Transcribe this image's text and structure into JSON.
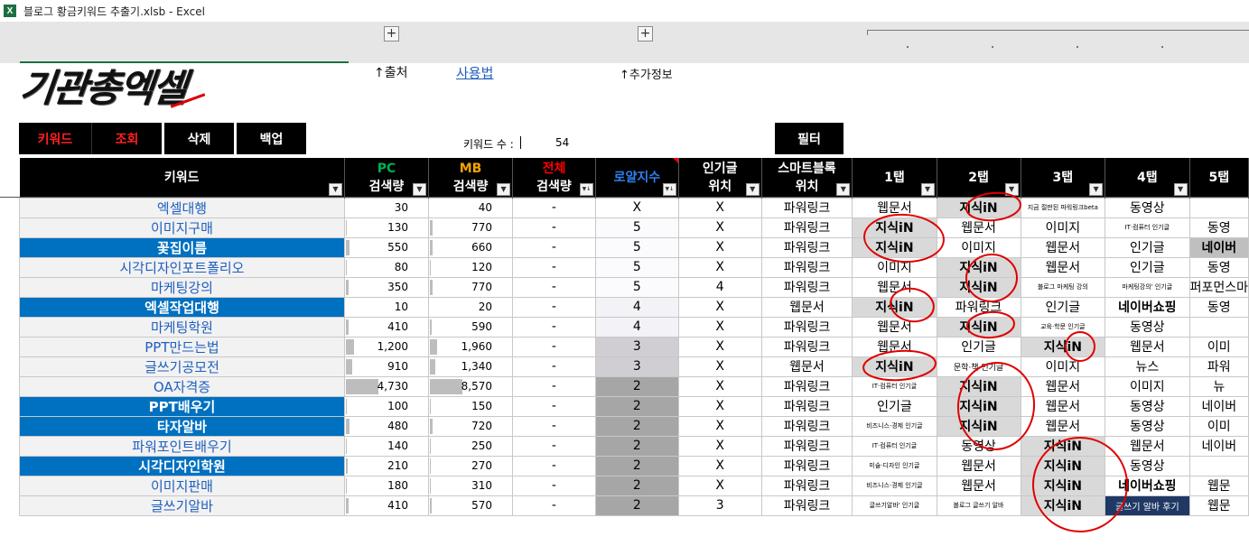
{
  "window": {
    "title": "블로그 황금키워드 추출기.xlsb - Excel",
    "icon": "excel-icon"
  },
  "ribbon": {
    "expand_buttons": [
      "+",
      "+"
    ]
  },
  "logo": {
    "text": "기관총엑셀"
  },
  "links": {
    "source": "↑출처",
    "usage": "사용법",
    "extra_info": "↑추가정보"
  },
  "buttons": {
    "keyword": "키워드",
    "lookup": "조회",
    "delete": "삭제",
    "backup": "백업",
    "filter": "필터"
  },
  "keyword_count": {
    "label": "키워드 수 :",
    "value": "54"
  },
  "colors": {
    "header_bg": "#000000",
    "highlight_blue": "#0070c0",
    "link_blue": "#1f5fbf",
    "pc_green": "#00b050",
    "mb_orange": "#f4a300",
    "total_red": "#ff0000",
    "royal_blue": "#2f80ed",
    "annotation_red": "#e00000"
  },
  "columns": [
    {
      "line1": "키워드",
      "line2": "",
      "color": "#ffffff"
    },
    {
      "line1": "PC",
      "line2": "검색량",
      "color": "#00b050"
    },
    {
      "line1": "MB",
      "line2": "검색량",
      "color": "#f4a300"
    },
    {
      "line1": "전체",
      "line2": "검색량",
      "color": "#ff0000"
    },
    {
      "line1": "로얄지수",
      "line2": "",
      "color": "#2f80ed"
    },
    {
      "line1": "인기글",
      "line2": "위치",
      "color": "#ffffff"
    },
    {
      "line1": "스마트블록",
      "line2": "위치",
      "color": "#ffffff"
    },
    {
      "line1": "1탭",
      "line2": "",
      "color": "#ffffff"
    },
    {
      "line1": "2탭",
      "line2": "",
      "color": "#ffffff"
    },
    {
      "line1": "3탭",
      "line2": "",
      "color": "#ffffff"
    },
    {
      "line1": "4탭",
      "line2": "",
      "color": "#ffffff"
    },
    {
      "line1": "5탭",
      "line2": "",
      "color": "#ffffff"
    }
  ],
  "rows": [
    {
      "kw": "엑셀대행",
      "hl": false,
      "pc": "30",
      "mb": "40",
      "total": "-",
      "royal": "X",
      "pop": "X",
      "smart": "파워링크",
      "t": [
        "웹문서",
        "지식iN",
        "지금 절판된 파워링크beta",
        "동영상",
        ""
      ]
    },
    {
      "kw": "이미지구매",
      "hl": false,
      "pc": "130",
      "mb": "770",
      "total": "-",
      "royal": "5",
      "pop": "X",
      "smart": "파워링크",
      "t": [
        "지식iN",
        "웹문서",
        "이미지",
        "IT·컴퓨터 인기글",
        "동영"
      ]
    },
    {
      "kw": "꽃집이름",
      "hl": true,
      "pc": "550",
      "mb": "660",
      "total": "-",
      "royal": "5",
      "pop": "X",
      "smart": "파워링크",
      "t": [
        "지식iN",
        "이미지",
        "웹문서",
        "인기글",
        "네이버"
      ]
    },
    {
      "kw": "시각디자인포트폴리오",
      "hl": false,
      "pc": "80",
      "mb": "120",
      "total": "-",
      "royal": "5",
      "pop": "X",
      "smart": "파워링크",
      "t": [
        "이미지",
        "지식iN",
        "웹문서",
        "인기글",
        "동영"
      ]
    },
    {
      "kw": "마케팅강의",
      "hl": false,
      "pc": "350",
      "mb": "770",
      "total": "-",
      "royal": "5",
      "pop": "4",
      "smart": "파워링크",
      "t": [
        "웹문서",
        "지식iN",
        "블로그 마케팅 강의",
        "마케팅강의' 인기글",
        "퍼포먼스마"
      ]
    },
    {
      "kw": "엑셀작업대행",
      "hl": true,
      "pc": "10",
      "mb": "20",
      "total": "-",
      "royal": "4",
      "pop": "X",
      "smart": "웹문서",
      "t": [
        "지식iN",
        "파워링크",
        "인기글",
        "네이버쇼핑",
        "동영"
      ]
    },
    {
      "kw": "마케팅학원",
      "hl": false,
      "pc": "410",
      "mb": "590",
      "total": "-",
      "royal": "4",
      "pop": "X",
      "smart": "파워링크",
      "t": [
        "웹문서",
        "지식iN",
        "교육·학문 인기글",
        "동영상",
        ""
      ]
    },
    {
      "kw": "PPT만드는법",
      "hl": false,
      "pc": "1,200",
      "mb": "1,960",
      "total": "-",
      "royal": "3",
      "pop": "X",
      "smart": "파워링크",
      "t": [
        "웹문서",
        "인기글",
        "지식iN",
        "웹문서",
        "이미"
      ]
    },
    {
      "kw": "글쓰기공모전",
      "hl": false,
      "pc": "910",
      "mb": "1,340",
      "total": "-",
      "royal": "3",
      "pop": "X",
      "smart": "웹문서",
      "t": [
        "지식iN",
        "문학·책 인기글",
        "이미지",
        "뉴스",
        "파워"
      ]
    },
    {
      "kw": "OA자격증",
      "hl": false,
      "pc": "4,730",
      "mb": "8,570",
      "total": "-",
      "royal": "2",
      "pop": "X",
      "smart": "파워링크",
      "t": [
        "IT·컴퓨터 인기글",
        "지식iN",
        "웹문서",
        "이미지",
        "뉴"
      ]
    },
    {
      "kw": "PPT배우기",
      "hl": true,
      "pc": "100",
      "mb": "150",
      "total": "-",
      "royal": "2",
      "pop": "X",
      "smart": "파워링크",
      "t": [
        "인기글",
        "지식iN",
        "웹문서",
        "동영상",
        "네이버"
      ]
    },
    {
      "kw": "타자알바",
      "hl": true,
      "pc": "480",
      "mb": "720",
      "total": "-",
      "royal": "2",
      "pop": "X",
      "smart": "파워링크",
      "t": [
        "비즈니스·경제 인기글",
        "지식iN",
        "웹문서",
        "동영상",
        "이미"
      ]
    },
    {
      "kw": "파워포인트배우기",
      "hl": false,
      "pc": "140",
      "mb": "250",
      "total": "-",
      "royal": "2",
      "pop": "X",
      "smart": "파워링크",
      "t": [
        "IT·컴퓨터 인기글",
        "동영상",
        "지식iN",
        "웹문서",
        "네이버"
      ]
    },
    {
      "kw": "시각디자인학원",
      "hl": true,
      "pc": "210",
      "mb": "270",
      "total": "-",
      "royal": "2",
      "pop": "X",
      "smart": "파워링크",
      "t": [
        "미술·디자인 인기글",
        "웹문서",
        "지식iN",
        "동영상",
        ""
      ]
    },
    {
      "kw": "이미지판매",
      "hl": false,
      "pc": "180",
      "mb": "310",
      "total": "-",
      "royal": "2",
      "pop": "X",
      "smart": "파워링크",
      "t": [
        "비즈니스·경제 인기글",
        "웹문서",
        "지식iN",
        "네이버쇼핑",
        "웹문"
      ]
    },
    {
      "kw": "글쓰기알바",
      "hl": false,
      "pc": "410",
      "mb": "570",
      "total": "-",
      "royal": "2",
      "pop": "3",
      "smart": "파워링크",
      "t": [
        "글쓰기알바' 인기글",
        "블로그 글쓰기 알바",
        "지식iN",
        "글쓰기 알바 후기",
        "웹문"
      ]
    }
  ]
}
